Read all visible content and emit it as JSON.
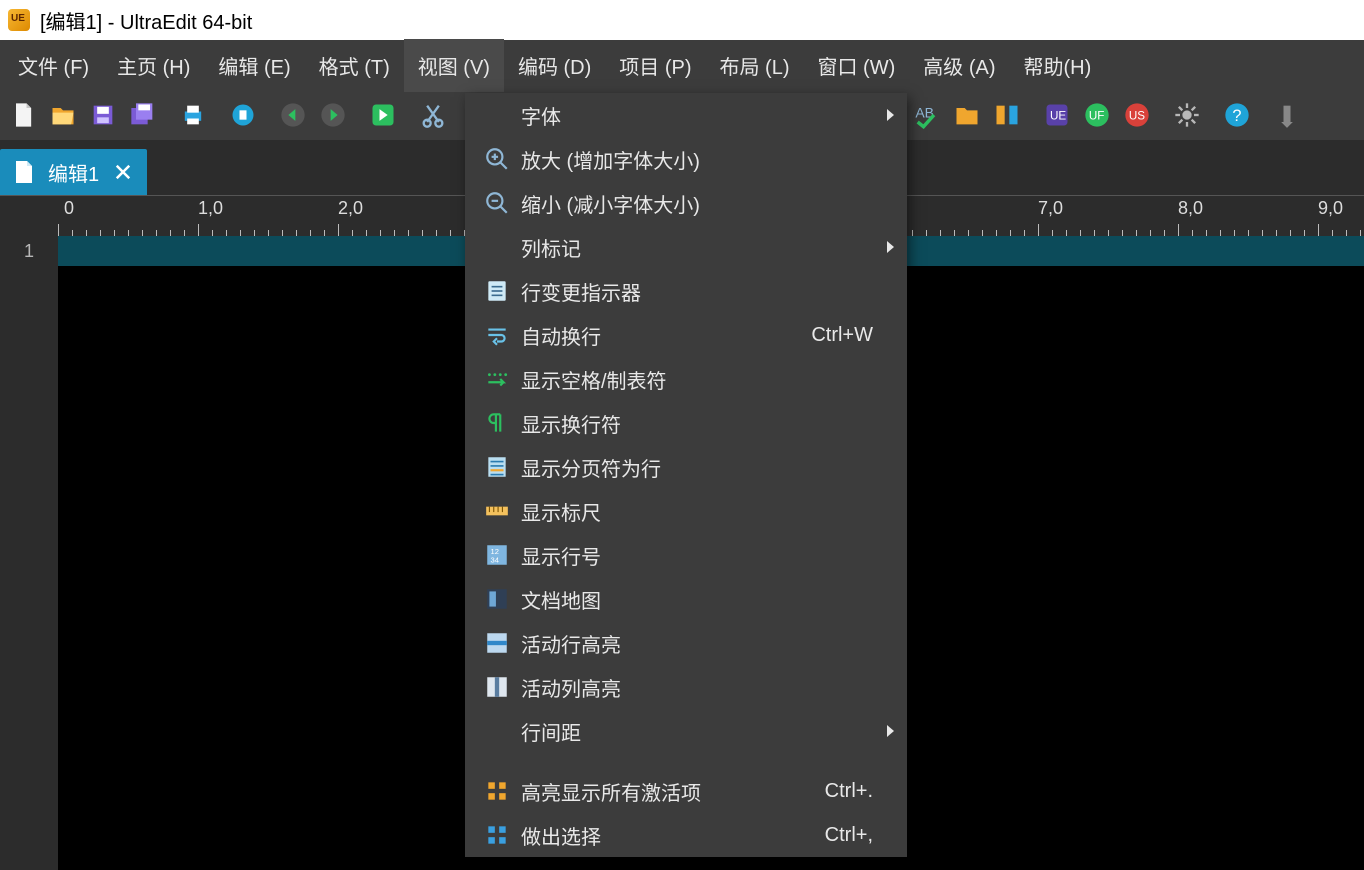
{
  "window": {
    "title": "[编辑1] - UltraEdit 64-bit"
  },
  "menubar": {
    "items": [
      {
        "label": "文件 (F)"
      },
      {
        "label": "主页 (H)"
      },
      {
        "label": "编辑 (E)"
      },
      {
        "label": "格式 (T)"
      },
      {
        "label": "视图 (V)",
        "active": true
      },
      {
        "label": "编码 (D)"
      },
      {
        "label": "项目 (P)"
      },
      {
        "label": "布局 (L)"
      },
      {
        "label": "窗口 (W)"
      },
      {
        "label": "高级 (A)"
      },
      {
        "label": "帮助(H)"
      }
    ]
  },
  "tab": {
    "label": "编辑1"
  },
  "gutter": {
    "line1": "1"
  },
  "ruler": {
    "marks": [
      "0",
      "1,0",
      "2,0",
      "",
      "",
      "",
      "",
      "7,0",
      "8,0",
      "9,0"
    ]
  },
  "view_menu": {
    "items": [
      {
        "icon": "",
        "label": "字体",
        "shortcut": "",
        "submenu": true
      },
      {
        "icon": "zoom-in-icon",
        "label": "放大 (增加字体大小)",
        "shortcut": "",
        "submenu": false
      },
      {
        "icon": "zoom-out-icon",
        "label": "缩小 (减小字体大小)",
        "shortcut": "",
        "submenu": false
      },
      {
        "icon": "",
        "label": "列标记",
        "shortcut": "",
        "submenu": true
      },
      {
        "icon": "document-icon",
        "label": "行变更指示器",
        "shortcut": "",
        "submenu": false
      },
      {
        "icon": "wrap-icon",
        "label": "自动换行",
        "shortcut": "Ctrl+W",
        "submenu": false
      },
      {
        "icon": "spaces-icon",
        "label": "显示空格/制表符",
        "shortcut": "",
        "submenu": false
      },
      {
        "icon": "pilcrow-icon",
        "label": "显示换行符",
        "shortcut": "",
        "submenu": false
      },
      {
        "icon": "page-lines-icon",
        "label": "显示分页符为行",
        "shortcut": "",
        "submenu": false
      },
      {
        "icon": "ruler-icon",
        "label": "显示标尺",
        "shortcut": "",
        "submenu": false
      },
      {
        "icon": "numbers-icon",
        "label": "显示行号",
        "shortcut": "",
        "submenu": false
      },
      {
        "icon": "docmap-icon",
        "label": "文档地图",
        "shortcut": "",
        "submenu": false
      },
      {
        "icon": "rowhi-icon",
        "label": "活动行高亮",
        "shortcut": "",
        "submenu": false
      },
      {
        "icon": "colhi-icon",
        "label": "活动列高亮",
        "shortcut": "",
        "submenu": false
      },
      {
        "icon": "",
        "label": "行间距",
        "shortcut": "",
        "submenu": true
      },
      {
        "sep": true
      },
      {
        "icon": "blocks-icon",
        "label": "高亮显示所有激活项",
        "shortcut": "Ctrl+.",
        "submenu": false
      },
      {
        "icon": "blocks2-icon",
        "label": "做出选择",
        "shortcut": "Ctrl+,",
        "submenu": false
      }
    ]
  }
}
